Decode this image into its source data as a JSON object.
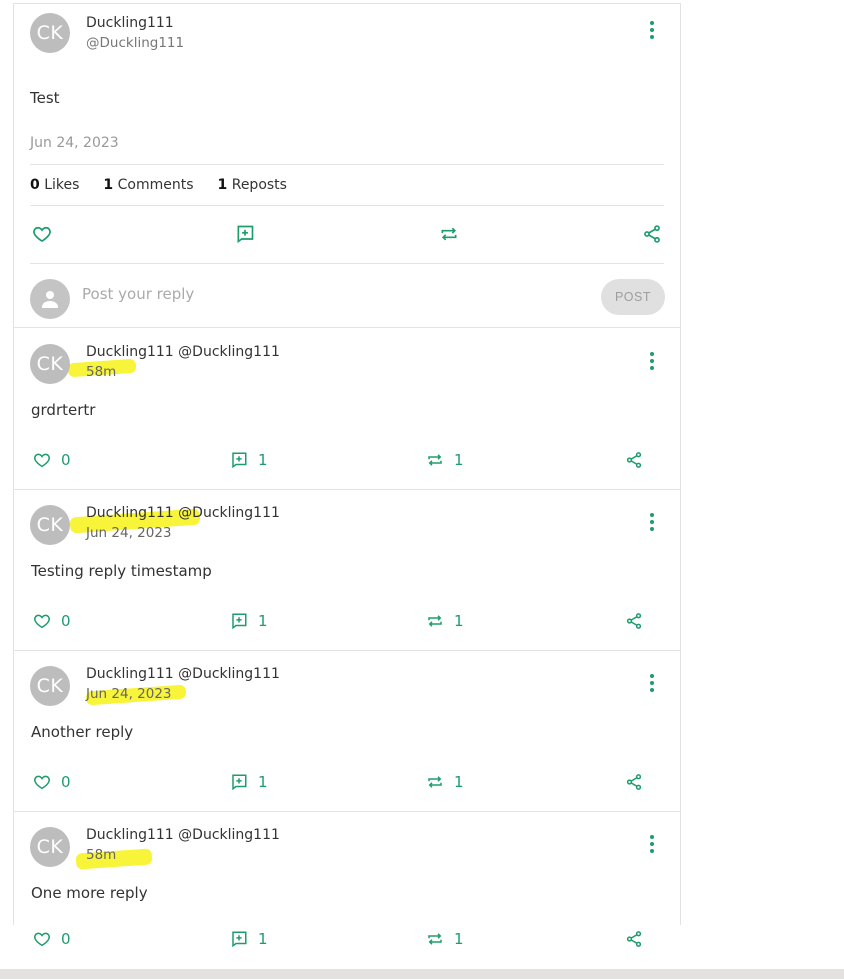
{
  "post": {
    "avatar_initials": "CK",
    "author_name": "Duckling111",
    "author_handle": "@Duckling111",
    "text": "Test",
    "date": "Jun 24, 2023",
    "stats": {
      "likes_count": "0",
      "likes_label": "Likes",
      "comments_count": "1",
      "comments_label": "Comments",
      "reposts_count": "1",
      "reposts_label": "Reposts"
    }
  },
  "reply_composer": {
    "placeholder": "Post your reply",
    "post_label": "POST"
  },
  "replies": [
    {
      "avatar_initials": "CK",
      "header": "Duckling111 @Duckling111",
      "time": "58m",
      "text": "grdrtertr",
      "likes": "0",
      "comments": "1",
      "reposts": "1"
    },
    {
      "avatar_initials": "CK",
      "header": "Duckling111 @Duckling111",
      "time": "Jun 24, 2023",
      "text": "Testing reply timestamp",
      "likes": "0",
      "comments": "1",
      "reposts": "1"
    },
    {
      "avatar_initials": "CK",
      "header": "Duckling111 @Duckling111",
      "time": "Jun 24, 2023",
      "text": "Another reply",
      "likes": "0",
      "comments": "1",
      "reposts": "1"
    },
    {
      "avatar_initials": "CK",
      "header": "Duckling111 @Duckling111",
      "time": "58m",
      "text": "One more reply",
      "likes": "0",
      "comments": "1",
      "reposts": "1"
    }
  ],
  "colors": {
    "accent": "#1d9d6c",
    "highlight": "#f7f43a",
    "avatar": "#bdbdbd"
  },
  "icons": {
    "like": "heart-icon",
    "comment": "comment-add-icon",
    "repost": "repost-icon",
    "share": "share-icon",
    "more": "more-vertical-icon",
    "user": "user-icon"
  }
}
